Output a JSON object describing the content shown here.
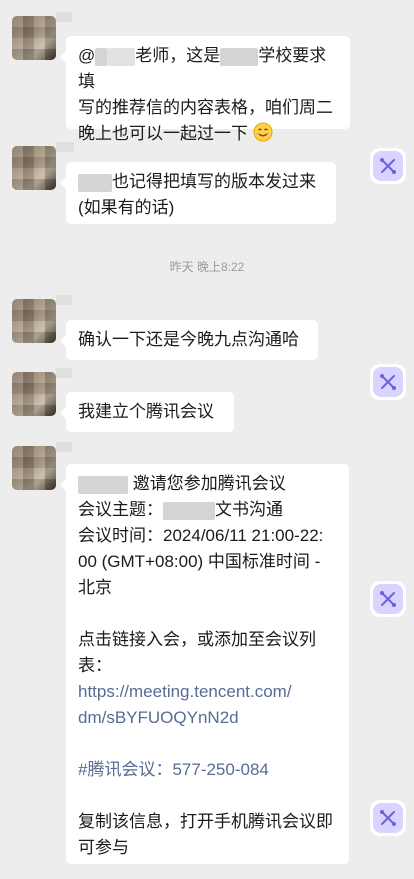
{
  "messages": [
    {
      "line1": "@",
      "line1b": "老师，这是",
      "line1c": "学校要求填",
      "line2": "写的推荐信的内容表格，咱们周二",
      "line3": "晚上也可以一起过一下"
    },
    {
      "line1": "也记得把填写的版本发过来",
      "line2": "(如果有的话)"
    },
    {
      "text": "确认一下还是今晚九点沟通哈"
    },
    {
      "text": "我建立个腾讯会议"
    },
    {
      "invite": "邀请您参加腾讯会议",
      "topic_label": "会议主题：",
      "topic_suffix": "文书沟通",
      "time_line1": "会议时间：2024/06/11 21:00-22:",
      "time_line2": "00 (GMT+08:00) 中国标准时间 -",
      "time_line3": "北京",
      "join_line1": "点击链接入会，或添加至会议列",
      "join_line2": "表：",
      "url_line1": "https://meeting.tencent.com/",
      "url_line2": "dm/sBYFUOQYnN2d",
      "meeting_id": "#腾讯会议：577-250-084",
      "copy_line1": "复制该信息，打开手机腾讯会议即",
      "copy_line2": "可参与"
    }
  ],
  "divider": "昨天 晚上8:22",
  "icons": [
    "smile-emoji-icon",
    "share-app-icon"
  ],
  "colors": {
    "background": "#ededed",
    "bubble": "#ffffff",
    "link": "#576b95"
  }
}
